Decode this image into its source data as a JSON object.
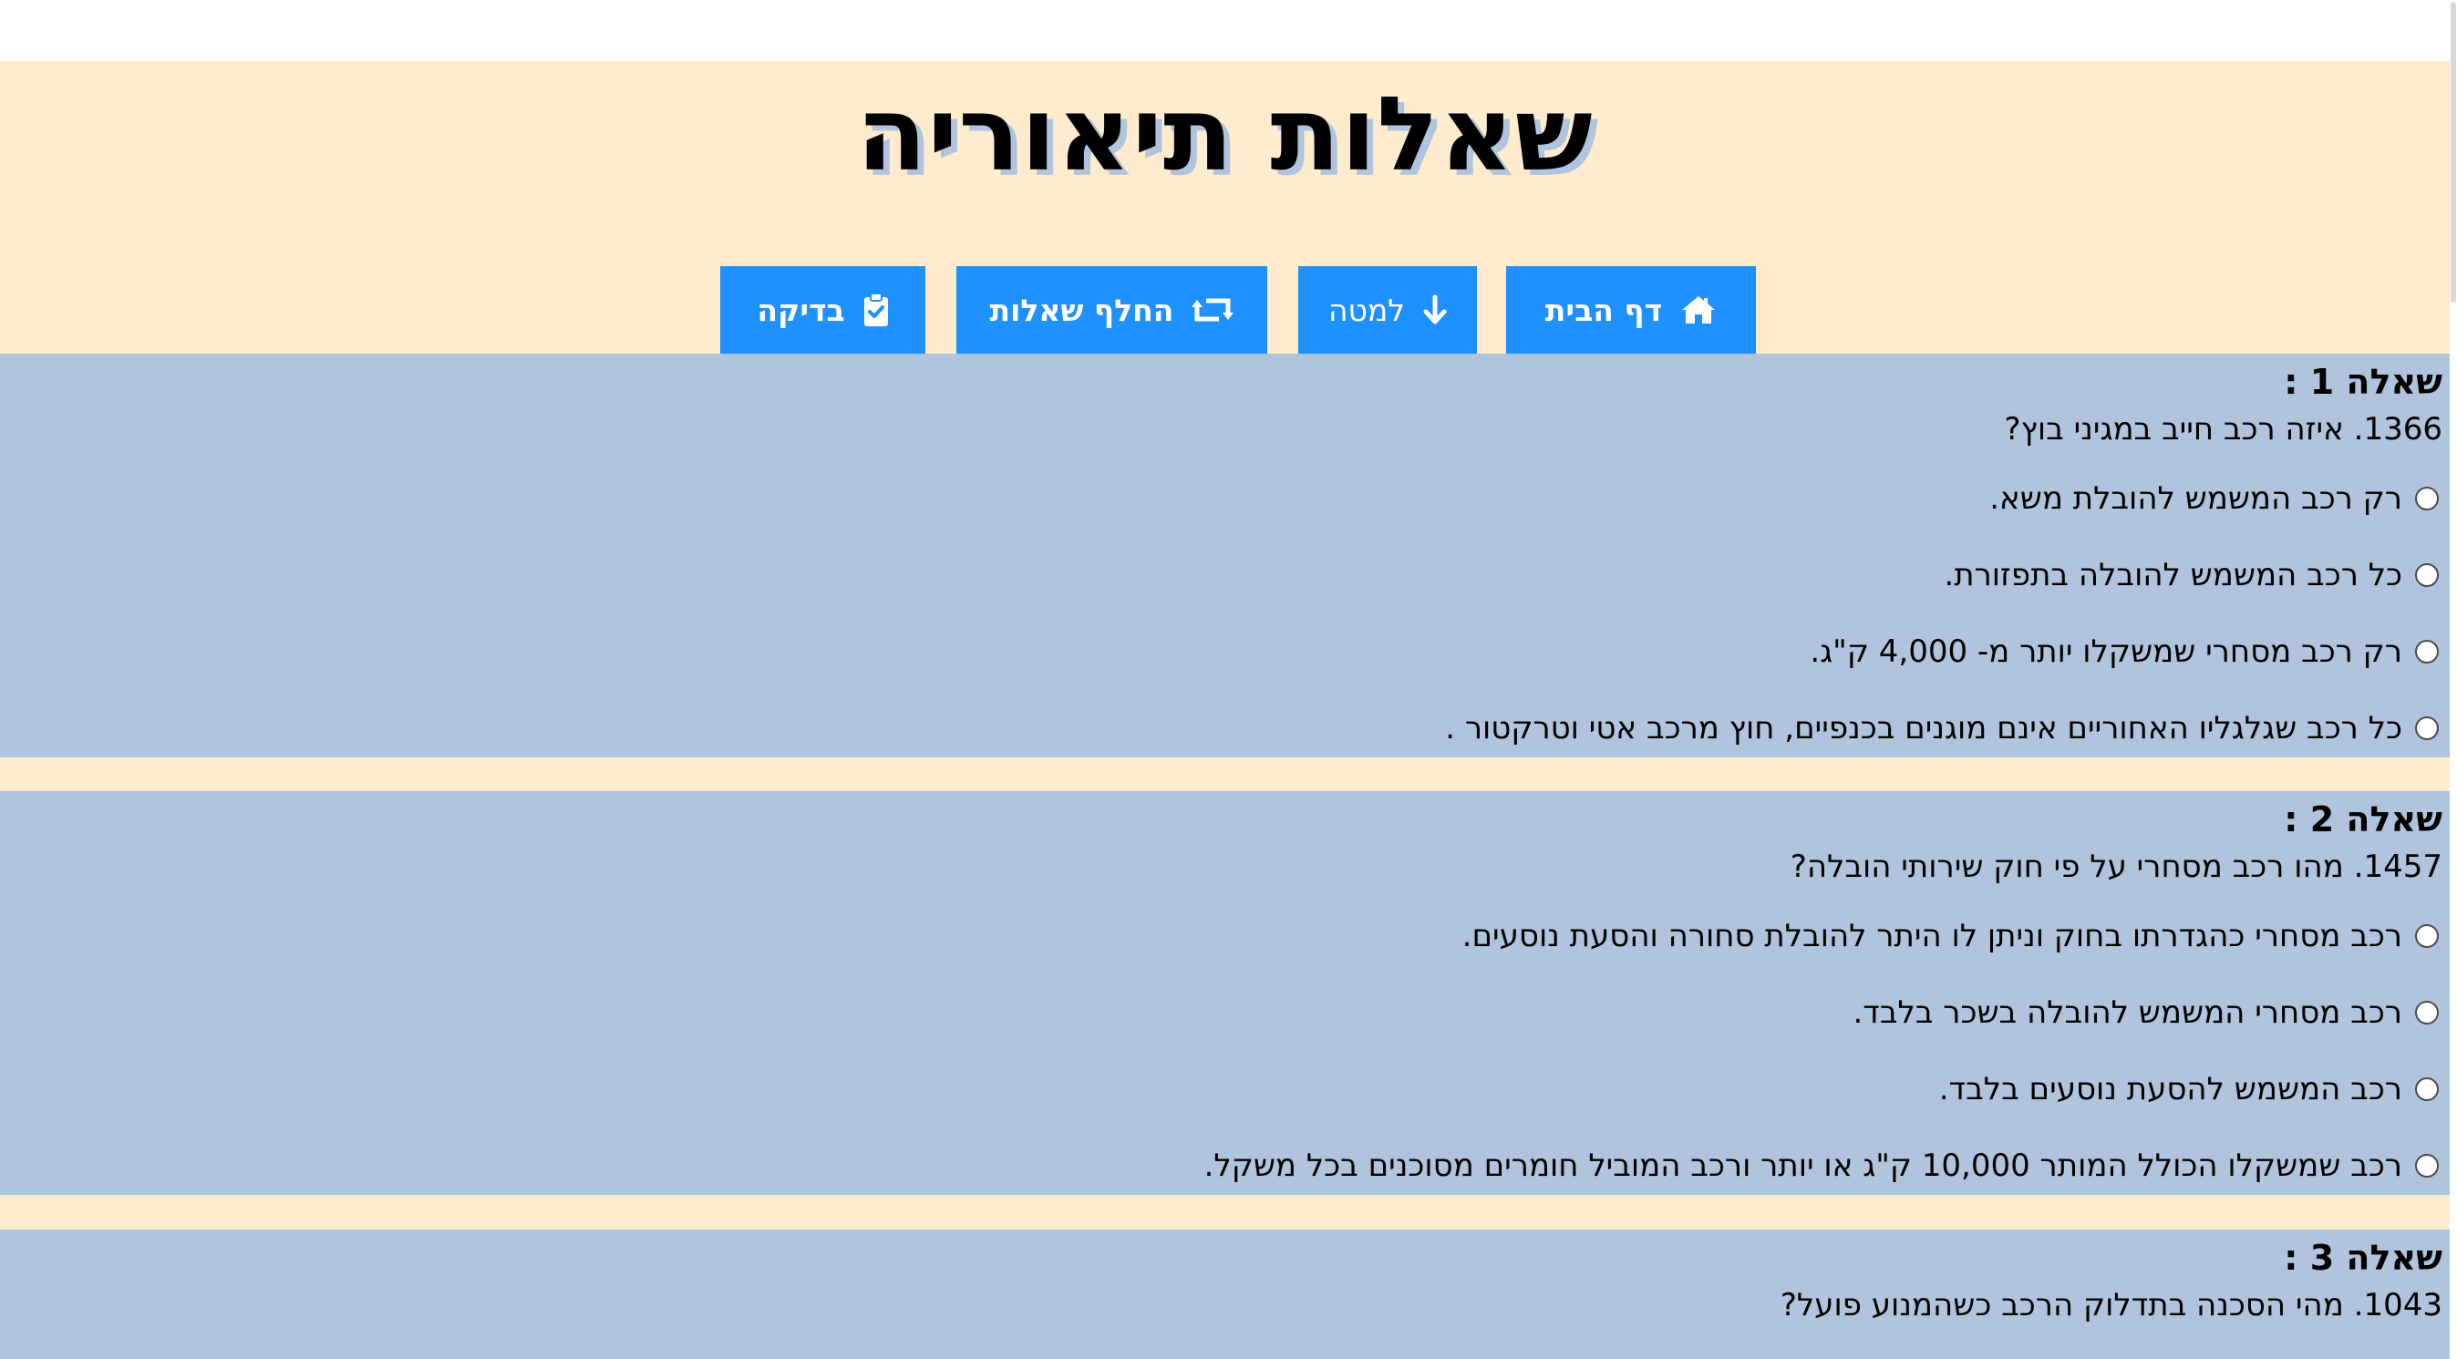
{
  "page": {
    "title": "שאלות תיאוריה"
  },
  "toolbar": {
    "home_label": "דף הבית",
    "home_icon": "home-icon",
    "down_label": "למטה",
    "down_icon": "arrow-down-icon",
    "swap_label": "החלף שאלות",
    "swap_icon": "retweet-icon",
    "check_label": "בדיקה",
    "check_icon": "clipboard-check-icon"
  },
  "colors": {
    "background": "#ffebcd",
    "question_block": "#b0c4de",
    "button": "#1e90ff",
    "button_text": "#ffffff"
  },
  "questions": [
    {
      "heading": "שאלה 1 :",
      "text": "1366. איזה רכב חייב במגיני בוץ?",
      "options": [
        "רק רכב המשמש להובלת משא.",
        "כל רכב המשמש להובלה בתפזורת.",
        "רק רכב מסחרי שמשקלו יותר מ- 4,000 ק\"ג.",
        "כל רכב שגלגליו האחוריים אינם מוגנים בכנפיים, חוץ מרכב אטי וטרקטור ."
      ]
    },
    {
      "heading": "שאלה 2 :",
      "text": "1457. מהו רכב מסחרי על פי חוק שירותי הובלה?",
      "options": [
        "רכב מסחרי כהגדרתו בחוק וניתן לו היתר להובלת סחורה והסעת נוסעים.",
        "רכב מסחרי המשמש להובלה בשכר בלבד.",
        "רכב המשמש להסעת נוסעים בלבד.",
        "רכב שמשקלו הכולל המותר 10,000 ק\"ג או יותר ורכב המוביל חומרים מסוכנים בכל משקל."
      ]
    },
    {
      "heading": "שאלה 3 :",
      "text": "1043. מהי הסכנה בתדלוק הרכב כשהמנוע פועל?"
    }
  ]
}
